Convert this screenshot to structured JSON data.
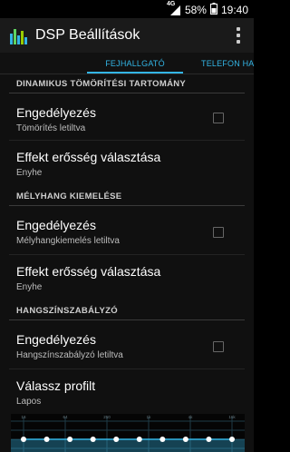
{
  "status_bar": {
    "network_label": "4G",
    "battery": "58%",
    "time": "19:40",
    "icons": [
      "signal-icon",
      "battery-icon"
    ]
  },
  "action_bar": {
    "title": "DSP Beállítások",
    "logo_icon": "equalizer-logo-icon",
    "menu_icon": "overflow-menu-icon"
  },
  "tabs": [
    {
      "label": "FEJHALLGATÓ",
      "active": true
    },
    {
      "label": "TELEFON HANGSZÓRÓ",
      "active": false
    }
  ],
  "colors": {
    "accent": "#33b5e5",
    "background": "#101010",
    "actionbar": "#1a1a1a"
  },
  "sections": [
    {
      "header": "DINAMIKUS TÖMÖRÍTÉSI TARTOMÁNY",
      "items": [
        {
          "title": "Engedélyezés",
          "summary": "Tömörítés letiltva",
          "checked": false
        },
        {
          "title": "Effekt erősség választása",
          "summary": "Enyhe"
        }
      ]
    },
    {
      "header": "MÉLYHANG KIEMELÉSE",
      "items": [
        {
          "title": "Engedélyezés",
          "summary": "Mélyhangkiemelés letiltva",
          "checked": false
        },
        {
          "title": "Effekt erősség választása",
          "summary": "Enyhe"
        }
      ]
    },
    {
      "header": "HANGSZÍNSZABÁLYZÓ",
      "items": [
        {
          "title": "Engedélyezés",
          "summary": "Hangszínszabályzó letiltva",
          "checked": false
        },
        {
          "title": "Válassz profilt",
          "summary": "Lapos"
        }
      ]
    }
  ],
  "equalizer": {
    "freq_labels": [
      "16",
      "64",
      "250",
      "1k",
      "4k",
      "16k"
    ],
    "band_count": 10,
    "levels": [
      0,
      0,
      0,
      0,
      0,
      0,
      0,
      0,
      0,
      0
    ]
  }
}
